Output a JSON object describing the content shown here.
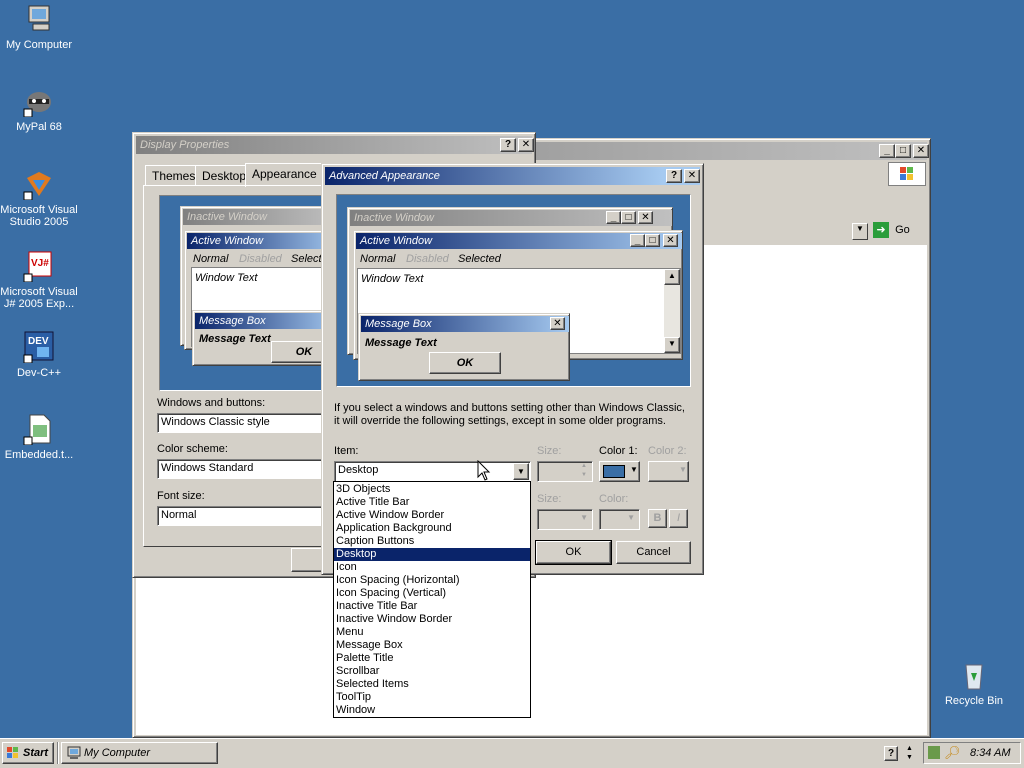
{
  "desktop": {
    "icons": [
      {
        "name": "my-computer",
        "label": "My Computer"
      },
      {
        "name": "mypal",
        "label": "MyPal 68"
      },
      {
        "name": "vs2005",
        "label": "Microsoft Visual Studio 2005"
      },
      {
        "name": "vjsharp",
        "label": "Microsoft Visual J# 2005 Exp..."
      },
      {
        "name": "devcpp",
        "label": "Dev-C++"
      },
      {
        "name": "embedded",
        "label": "Embedded.t..."
      },
      {
        "name": "recycle",
        "label": "Recycle Bin"
      }
    ]
  },
  "explorer": {
    "go_label": "Go"
  },
  "display_props": {
    "title": "Display Properties",
    "tabs": [
      "Themes",
      "Desktop",
      "Appearance"
    ],
    "preview": {
      "inactive": "Inactive Window",
      "active": "Active Window",
      "normal": "Normal",
      "disabled": "Disabled",
      "selected": "Selecte",
      "window_text": "Window Text",
      "message_box": "Message Box",
      "message_text": "Message Text",
      "ok": "OK"
    },
    "windows_buttons_label": "Windows and buttons:",
    "windows_buttons_value": "Windows Classic style",
    "color_scheme_label": "Color scheme:",
    "color_scheme_value": "Windows Standard",
    "font_size_label": "Font size:",
    "font_size_value": "Normal"
  },
  "advanced": {
    "title": "Advanced Appearance",
    "preview": {
      "inactive": "Inactive Window",
      "active": "Active Window",
      "normal": "Normal",
      "disabled": "Disabled",
      "selected": "Selected",
      "window_text": "Window Text",
      "message_box": "Message Box",
      "message_text": "Message Text",
      "ok": "OK"
    },
    "info_line1": "If you select a windows and buttons setting other than Windows Classic,",
    "info_line2": "it will override the following settings, except in some older programs.",
    "item_label": "Item:",
    "item_value": "Desktop",
    "size_label": "Size:",
    "color1_label": "Color 1:",
    "color2_label": "Color 2:",
    "font_size_label": "Size:",
    "font_color_label": "Color:",
    "bold": "B",
    "italic": "I",
    "color1_hex": "#3a6ea5",
    "ok": "OK",
    "cancel": "Cancel",
    "items": [
      "3D Objects",
      "Active Title Bar",
      "Active Window Border",
      "Application Background",
      "Caption Buttons",
      "Desktop",
      "Icon",
      "Icon Spacing (Horizontal)",
      "Icon Spacing (Vertical)",
      "Inactive Title Bar",
      "Inactive Window Border",
      "Menu",
      "Message Box",
      "Palette Title",
      "Scrollbar",
      "Selected Items",
      "ToolTip",
      "Window"
    ],
    "selected_item": "Desktop"
  },
  "taskbar": {
    "start": "Start",
    "task": "My Computer",
    "clock": "8:34 AM"
  }
}
